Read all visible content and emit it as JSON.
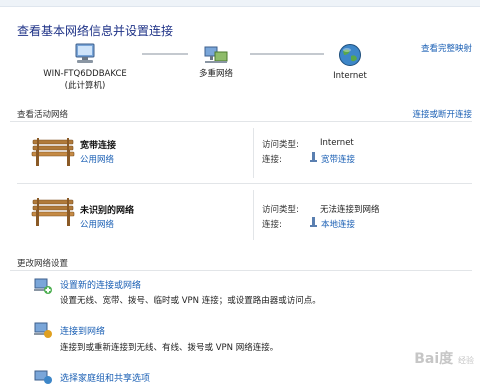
{
  "header": {
    "title": "查看基本网络信息并设置连接",
    "full_map_link": "查看完整映射"
  },
  "map": {
    "computer_name": "WIN-FTQ6DDBAKCE",
    "computer_sub": "(此计算机)",
    "middle_label": "多重网络",
    "internet_label": "Internet"
  },
  "active": {
    "section_label": "查看活动网络",
    "connect_link": "连接或断开连接",
    "networks": [
      {
        "name": "宽带连接",
        "type": "公用网络",
        "access_key": "访问类型:",
        "access_value": "Internet",
        "conn_key": "连接:",
        "conn_value": "宽带连接"
      },
      {
        "name": "未识别的网络",
        "type": "公用网络",
        "access_key": "访问类型:",
        "access_value": "无法连接到网络",
        "conn_key": "连接:",
        "conn_value": "本地连接"
      }
    ]
  },
  "change": {
    "section_label": "更改网络设置",
    "tasks": [
      {
        "link": "设置新的连接或网络",
        "desc": "设置无线、宽带、拨号、临时或 VPN 连接；或设置路由器或访问点。"
      },
      {
        "link": "连接到网络",
        "desc": "连接到或重新连接到无线、有线、拨号或 VPN 网络连接。"
      },
      {
        "link": "选择家庭组和共享选项",
        "desc": ""
      }
    ]
  },
  "watermark": {
    "text": "Bai度",
    "sub": "经验"
  }
}
